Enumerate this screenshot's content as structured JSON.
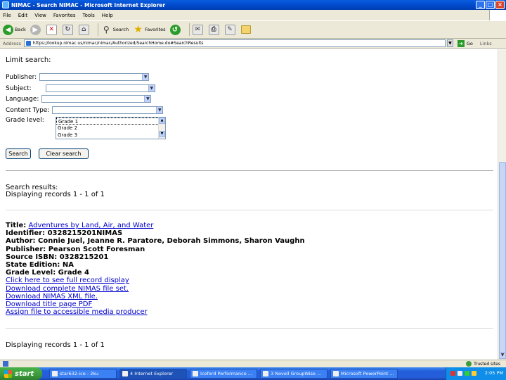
{
  "window": {
    "title": "NIMAC - Search NIMAC - Microsoft Internet Explorer",
    "buttons": {
      "minimize": "_",
      "maximize": "□",
      "close": "×"
    }
  },
  "menu": [
    "File",
    "Edit",
    "View",
    "Favorites",
    "Tools",
    "Help"
  ],
  "toolbar": {
    "back": "Back",
    "search": "Search",
    "favorites": "Favorites"
  },
  "address": {
    "label": "Address",
    "url": "https://lookup.nimac.us/nimac/nimac/Authorized/SearchHome.do#SearchResults",
    "go": "Go",
    "links": "Links"
  },
  "limit_search": {
    "heading": "Limit search:",
    "publisher_label": "Publisher:",
    "subject_label": "Subject:",
    "language_label": "Language:",
    "content_type_label": "Content Type:",
    "grade_level_label": "Grade level:",
    "grade_options": [
      "Grade 1",
      "Grade 2",
      "Grade 3"
    ],
    "search_button": "Search",
    "clear_button": "Clear search"
  },
  "results": {
    "heading": "Search results:",
    "displaying_top": "Displaying records 1 - 1 of 1",
    "displaying_bottom": "Displaying records 1 - 1 of 1",
    "record": {
      "title_label": "Title:",
      "title_value": "Adventures by Land, Air, and Water",
      "identifier": "Identifier: 0328215201NIMAS",
      "author": "Author: Connie Juel, Jeanne R. Paratore, Deborah Simmons, Sharon Vaughn",
      "publisher": "Publisher: Pearson Scott Foresman",
      "source_isbn": "Source ISBN: 0328215201",
      "state_edition": "State Edition: NA",
      "grade_level": "Grade Level: Grade 4",
      "links": [
        "Click here to see full record display",
        "Download complete NIMAS file set.",
        "Download NIMAS XML file.",
        "Download title page PDF",
        "Assign file to accessible media producer"
      ]
    }
  },
  "status": {
    "zone": "Trusted sites"
  },
  "taskbar": {
    "start": "start",
    "tasks": [
      "star632-ice - 2ku",
      "4 Internet Explorer",
      "Iceford Performance ...",
      "3 Novell GroupWise ...",
      "Microsoft PowerPoint ..."
    ],
    "clock": "2:05 PM"
  }
}
